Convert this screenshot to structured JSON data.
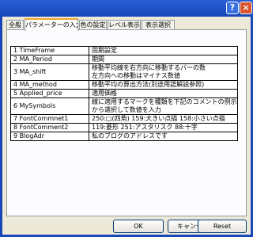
{
  "tabs": [
    "全般",
    "パラメーターの入力",
    "色の設定",
    "レベル表示",
    "表示選択"
  ],
  "active_tab": "パラメーターの入力",
  "params": [
    {
      "name": "1 TimeFrame",
      "desc": [
        "固期設定"
      ]
    },
    {
      "name": "2 MA_Period",
      "desc": [
        "期間"
      ]
    },
    {
      "name": "3 MA_shift",
      "desc": [
        "移動平均線を右方向に移動するバーの数",
        "左方向への移動はマイナス数値"
      ]
    },
    {
      "name": "4 MA_method",
      "desc": [
        "移動平均の算出方法(別途用語解説参照)"
      ]
    },
    {
      "name": "5 Applied_price",
      "desc": [
        "適用価格"
      ]
    },
    {
      "name": "6 MySymbols",
      "desc": [
        "線に適用するマークを種類を下記のコメントの例示",
        "から選択して数値を入力"
      ]
    },
    {
      "name": "7 FontCommnet1",
      "desc": [
        "250:□(四角) 159:大きい点描 158:小さい点描"
      ]
    },
    {
      "name": "8 FontComment2",
      "desc": [
        "119:菱形 251:アスタリスク 88:十字"
      ]
    },
    {
      "name": "9 BlogAdr",
      "desc": [
        "私のブログのアドレスです"
      ]
    }
  ],
  "buttons": {
    "ok": "OK",
    "cancel": "キャンセル",
    "reset": "Reset"
  },
  "titlebar": {
    "help": "?",
    "close": "×"
  }
}
